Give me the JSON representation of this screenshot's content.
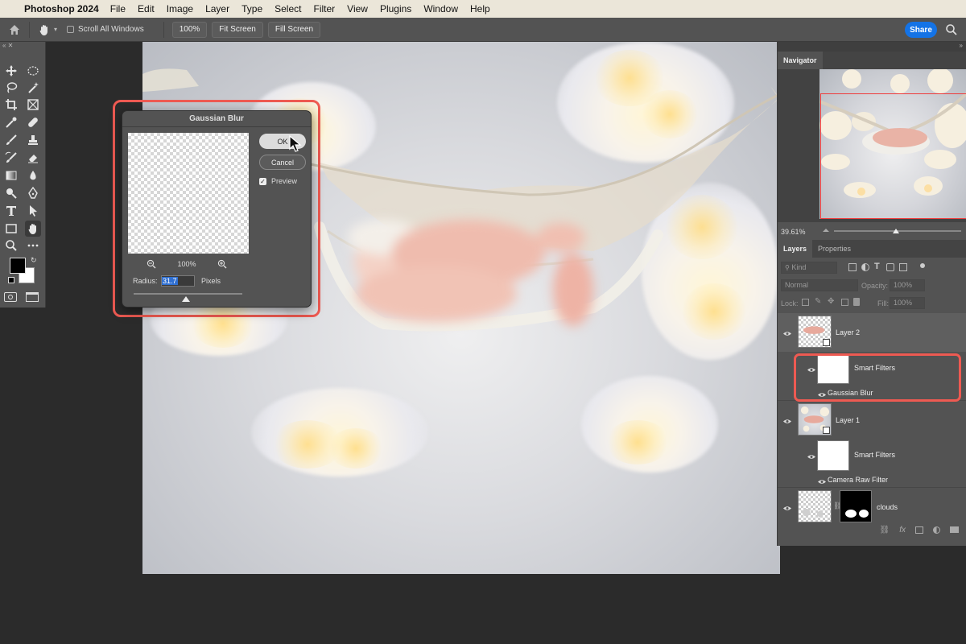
{
  "menubar": {
    "app_name": "Photoshop 2024",
    "items": [
      "File",
      "Edit",
      "Image",
      "Layer",
      "Type",
      "Select",
      "Filter",
      "View",
      "Plugins",
      "Window",
      "Help"
    ]
  },
  "optionsbar": {
    "scroll_all_label": "Scroll All Windows",
    "zoom_button": "100%",
    "fit_screen": "Fit Screen",
    "fill_screen": "Fill Screen",
    "share": "Share"
  },
  "dialog": {
    "title": "Gaussian Blur",
    "ok": "OK",
    "cancel": "Cancel",
    "preview_label": "Preview",
    "preview_checked": true,
    "zoom": "100%",
    "radius_label": "Radius:",
    "radius_value": "31.7",
    "radius_unit": "Pixels"
  },
  "navigator": {
    "tab": "Navigator",
    "zoom": "39.61%"
  },
  "layers_panel": {
    "tabs": [
      "Layers",
      "Properties"
    ],
    "kind_placeholder": "Kind",
    "blend_mode": "Normal",
    "opacity_label": "Opacity:",
    "opacity_value": "100%",
    "lock_label": "Lock:",
    "fill_label": "Fill:",
    "fill_value": "100%",
    "layers": [
      {
        "name": "Layer 2",
        "smart_filters_label": "Smart Filters",
        "filter": "Gaussian Blur"
      },
      {
        "name": "Layer 1",
        "smart_filters_label": "Smart Filters",
        "filter": "Camera Raw Filter"
      },
      {
        "name": "clouds"
      }
    ]
  },
  "colors": {
    "accent": "#1473e6",
    "highlight": "#ee5a52",
    "panel_bg": "#535353",
    "app_bg": "#2b2b2b"
  }
}
